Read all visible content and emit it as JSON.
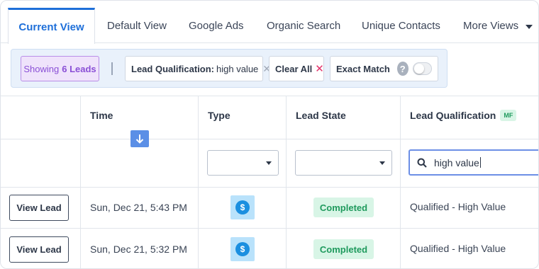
{
  "tabs": [
    {
      "label": "Current View",
      "active": true
    },
    {
      "label": "Default View"
    },
    {
      "label": "Google Ads"
    },
    {
      "label": "Organic Search"
    },
    {
      "label": "Unique Contacts"
    },
    {
      "label": "More Views"
    }
  ],
  "filters": {
    "showing_prefix": "Showing",
    "showing_count": "6 Leads",
    "lead_qualification_label": "Lead Qualification:",
    "lead_qualification_value": "high value",
    "remove_icon": "✕",
    "clear_all": "Clear All",
    "clear_icon": "✕",
    "exact_match": "Exact Match",
    "help_glyph": "?",
    "exact_match_enabled": false
  },
  "columns": {
    "time": "Time",
    "type": "Type",
    "lead_state": "Lead State",
    "lead_qualification": "Lead Qualification",
    "lead_qualification_badge": "MF"
  },
  "column_filters": {
    "type_value": "",
    "lead_state_value": "",
    "lead_qualification_search": "high value"
  },
  "rows": [
    {
      "action": "View Lead",
      "time": "Sun, Dec 21, 5:43 PM",
      "type_icon": "dollar-icon",
      "type_glyph": "$",
      "lead_state": "Completed",
      "lead_qualification": "Qualified - High Value"
    },
    {
      "action": "View Lead",
      "time": "Sun, Dec 21, 5:32 PM",
      "type_icon": "dollar-icon",
      "type_glyph": "$",
      "lead_state": "Completed",
      "lead_qualification": "Qualified - High Value"
    }
  ],
  "colors": {
    "accent": "#1e6fd9",
    "showing_purple": "#8a4fd6",
    "completed_green": "#1f9a5d",
    "clear_pink": "#e2336b"
  }
}
